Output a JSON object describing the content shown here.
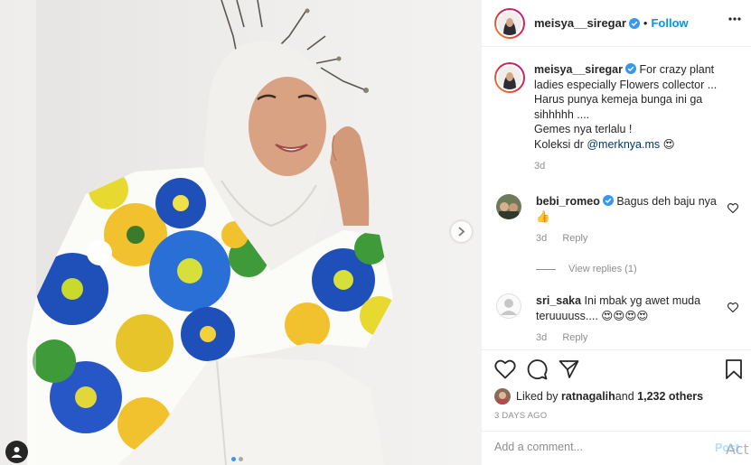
{
  "post": {
    "username": "meisya__siregar",
    "follow_label": "Follow",
    "dot": "•",
    "caption_lines": [
      "For crazy plant",
      "ladies especially Flowers collector ...",
      "Harus punya kemeja bunga ini ga",
      "sihhhhh ....",
      "Gemes nya terlalu !"
    ],
    "caption_last_prefix": "Koleksi dr ",
    "caption_mention": "@merknya.ms",
    "caption_emoji": "😍",
    "caption_time": "3d"
  },
  "comments": [
    {
      "username": "bebi_romeo",
      "text": "Bagus deh baju nya",
      "emoji": "👍",
      "time": "3d",
      "reply_label": "Reply",
      "view_replies": "View replies (1)"
    },
    {
      "username": "sri_saka",
      "text": "Ini mbak yg awet muda teruuuuss....",
      "emoji": "😍😍😍😍",
      "time": "3d",
      "reply_label": "Reply"
    }
  ],
  "likes": {
    "prefix": "Liked by ",
    "user": "ratnagalih",
    "middle": " and ",
    "others": "1,232 others"
  },
  "timestamp": "3 DAYS AGO",
  "comment_box": {
    "placeholder": "Add a comment...",
    "post_label": "Post"
  },
  "watermark": "Act",
  "carousel": {
    "count": 2,
    "active_index": 0
  },
  "icons": {
    "more": "more-horizontal-icon",
    "like": "heart-icon",
    "comment": "comment-bubble-icon",
    "share": "paper-plane-icon",
    "save": "bookmark-icon",
    "next": "chevron-right-icon",
    "tag": "user-tag-icon",
    "verified": "verified-badge-icon"
  },
  "colors": {
    "link_blue": "#0095f6",
    "mention": "#00376b",
    "muted": "#8e8e8e",
    "verified": "#3897f0",
    "post_disabled": "#b2dffc"
  }
}
